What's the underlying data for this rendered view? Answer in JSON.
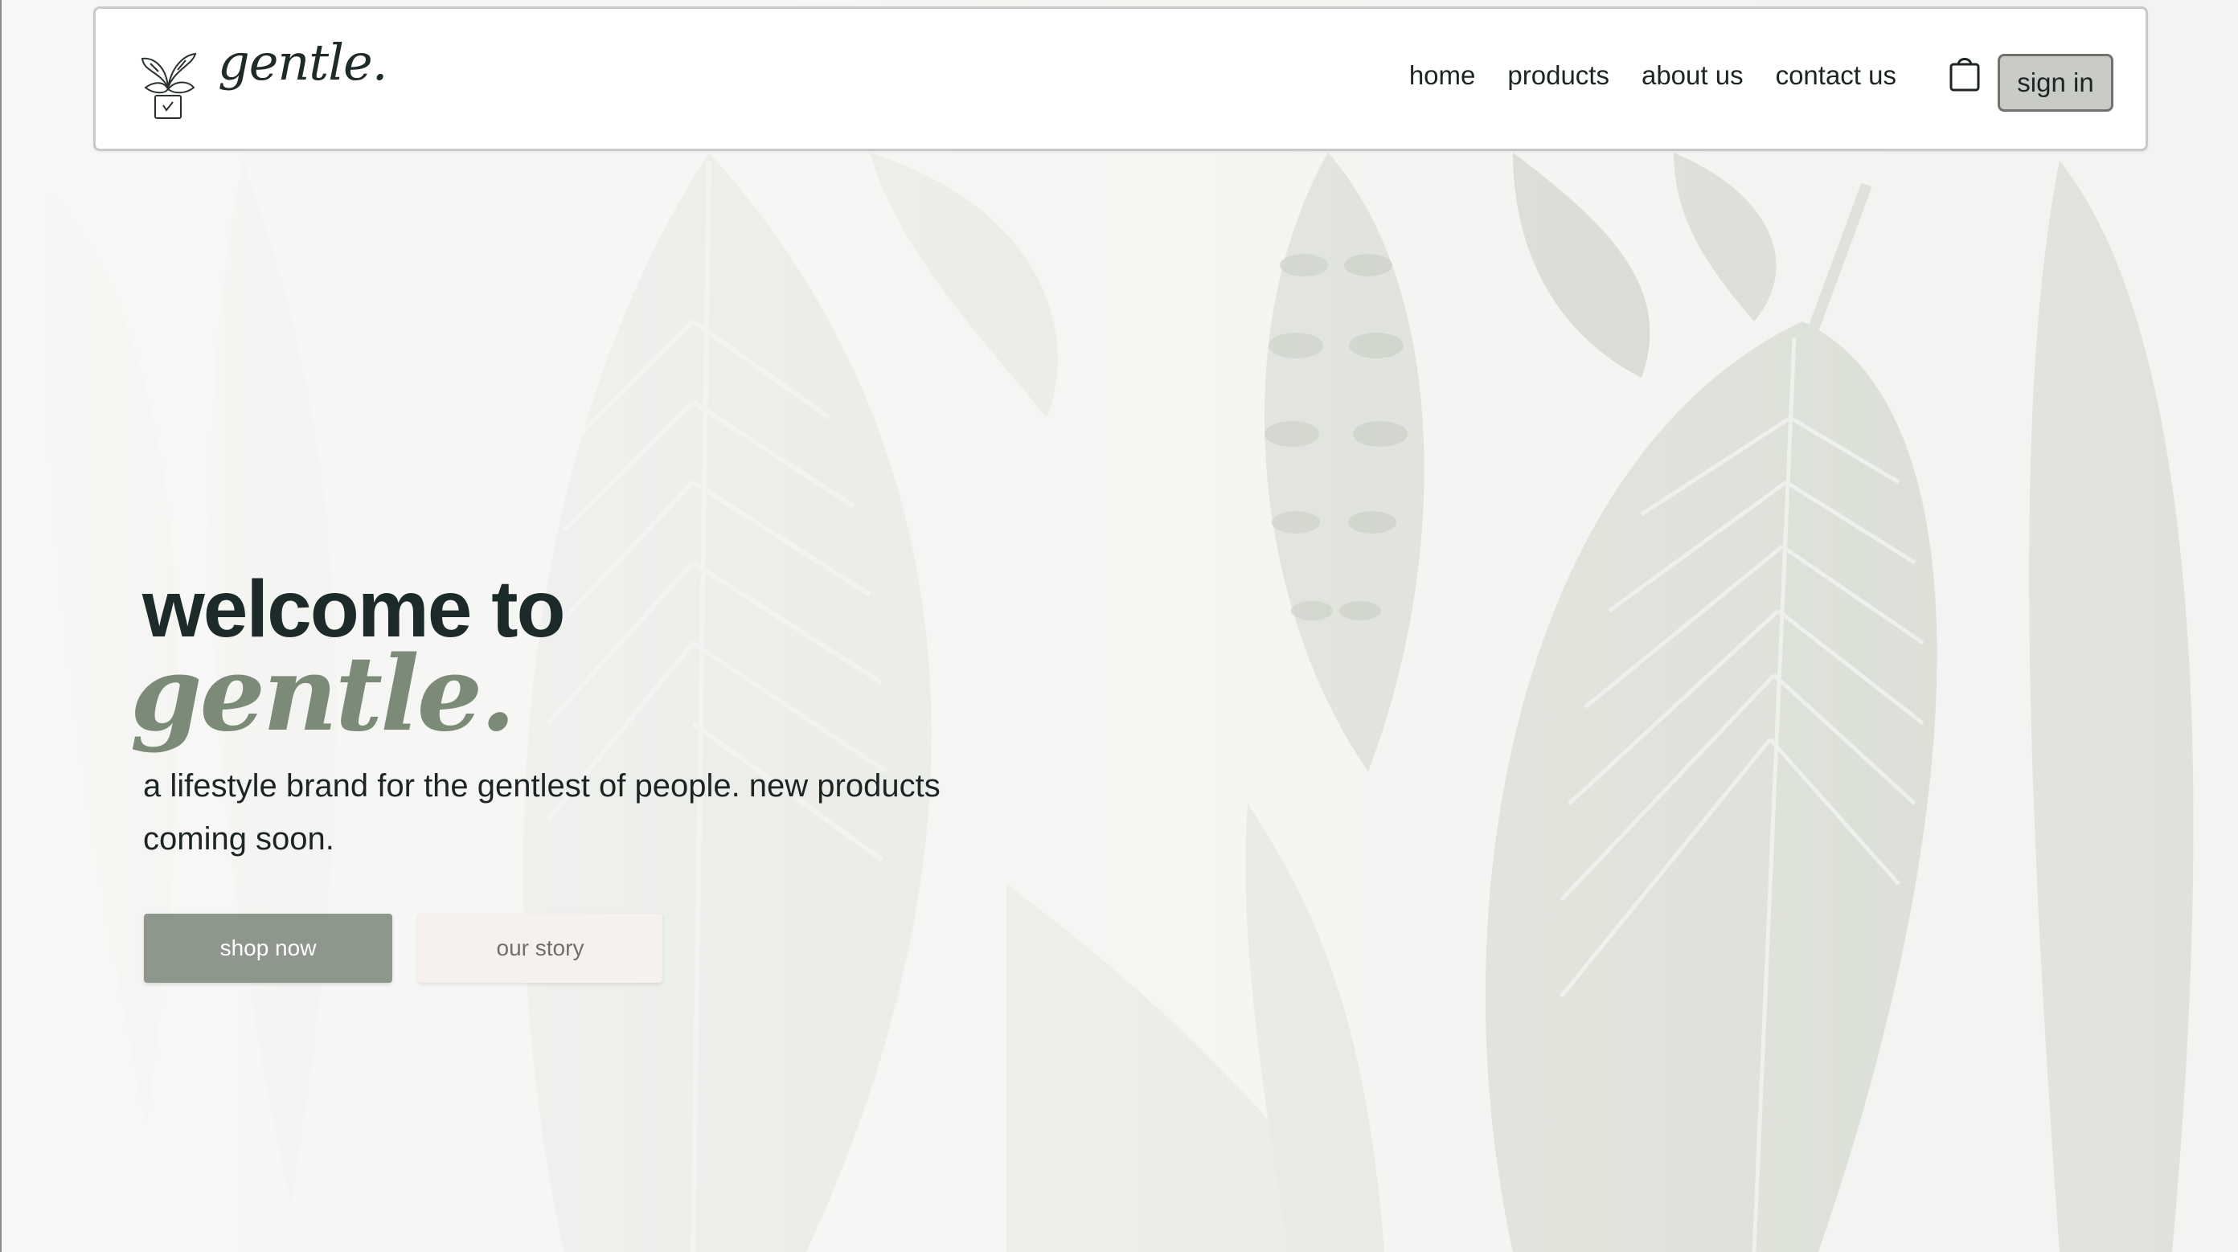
{
  "brand": {
    "name": "gentle.",
    "logo_icon": "potted-monstera-icon"
  },
  "nav": {
    "links": [
      "home",
      "products",
      "about us",
      "contact us"
    ],
    "cart_icon": "shopping-bag-icon",
    "signin_label": "sign in"
  },
  "hero": {
    "title": "welcome to",
    "script": "gentle.",
    "subtitle": "a lifestyle brand for the gentlest of people. new products coming soon.",
    "primary_button": "shop now",
    "secondary_button": "our story"
  },
  "colors": {
    "accent": "#8e978b",
    "script_green": "#7c8a78",
    "text_dark": "#1c2424",
    "signin_bg": "#c9ccc6",
    "story_bg": "#f6f1ee"
  }
}
